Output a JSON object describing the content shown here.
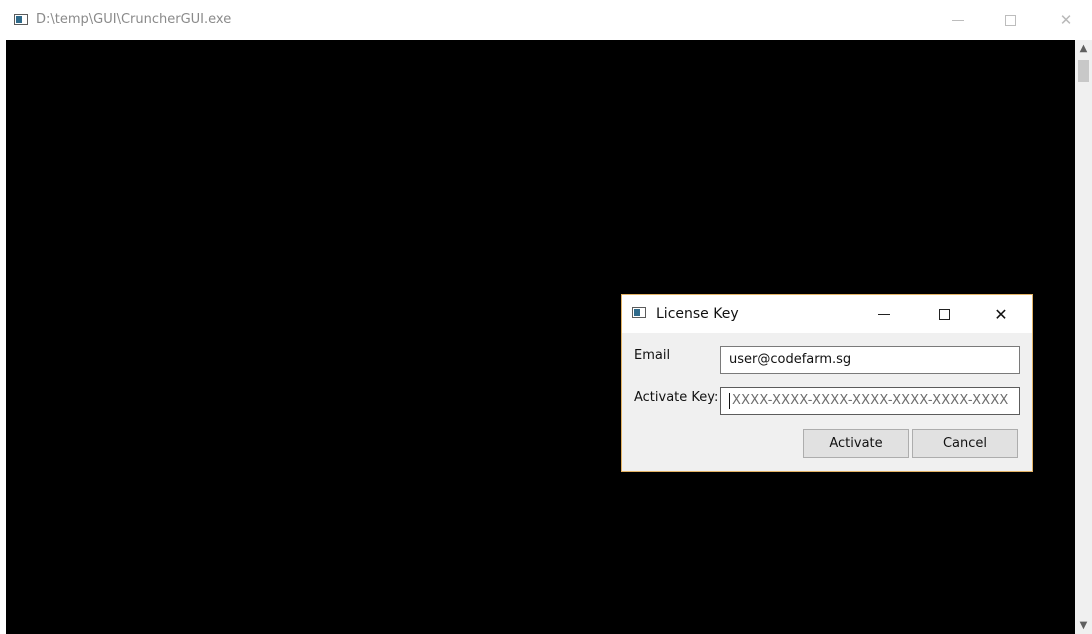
{
  "window": {
    "title": "D:\\temp\\GUI\\CruncherGUI.exe",
    "controls": {
      "minimize": "—",
      "maximize": "□",
      "close": "✕"
    }
  },
  "dialog": {
    "title": "License Key",
    "controls": {
      "minimize": "—",
      "maximize": "□",
      "close": "✕"
    },
    "email_label": "Email",
    "email_value": "user@codefarm.sg",
    "key_label": "Activate Key:",
    "key_placeholder": "XXXX-XXXX-XXXX-XXXX-XXXX-XXXX-XXXX",
    "activate_label": "Activate",
    "cancel_label": "Cancel"
  },
  "colors": {
    "console_bg": "#000000",
    "dialog_border": "#e3b365",
    "dialog_bg": "#f0f0f0"
  }
}
